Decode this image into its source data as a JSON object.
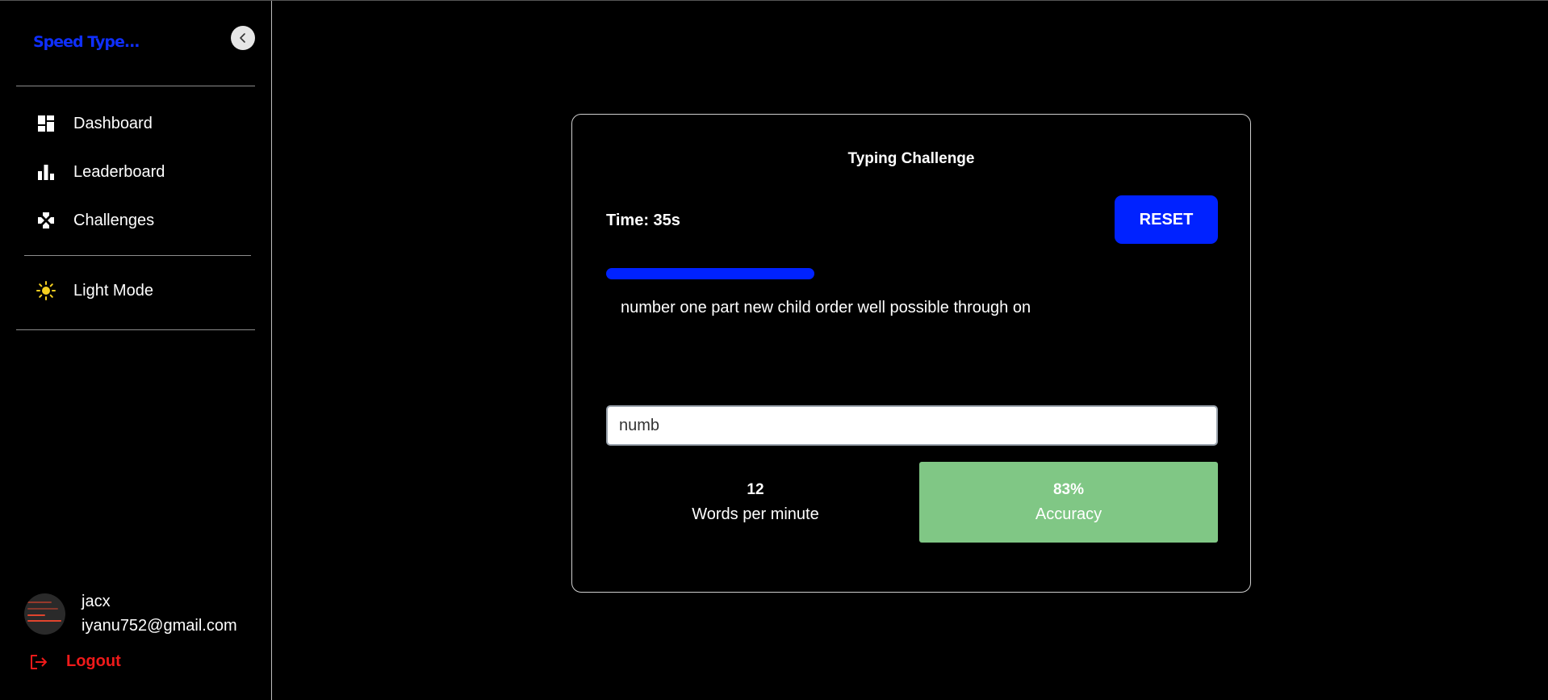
{
  "sidebar": {
    "brand": "Speed Type...",
    "nav": [
      {
        "label": "Dashboard",
        "icon": "dashboard-icon"
      },
      {
        "label": "Leaderboard",
        "icon": "bar-chart-icon"
      },
      {
        "label": "Challenges",
        "icon": "gamepad-icon"
      }
    ],
    "theme_toggle": {
      "label": "Light Mode",
      "icon": "sun-icon"
    },
    "user": {
      "name": "jacx",
      "email": "iyanu752@gmail.com"
    },
    "logout_label": "Logout"
  },
  "challenge": {
    "title": "Typing Challenge",
    "timer": "Time: 35s",
    "reset_label": "RESET",
    "progress": 0.34,
    "prompt": "number one part new child order well possible through on",
    "input_value": "numb",
    "stats": {
      "wpm_value": "12",
      "wpm_label": "Words per minute",
      "accuracy_value": "83%",
      "accuracy_label": "Accuracy"
    }
  },
  "colors": {
    "accent": "#0022ff",
    "brand": "#0f2fff",
    "accuracy_bg": "#80c785",
    "logout": "#ee1a1a",
    "sun": "#f5d020"
  }
}
